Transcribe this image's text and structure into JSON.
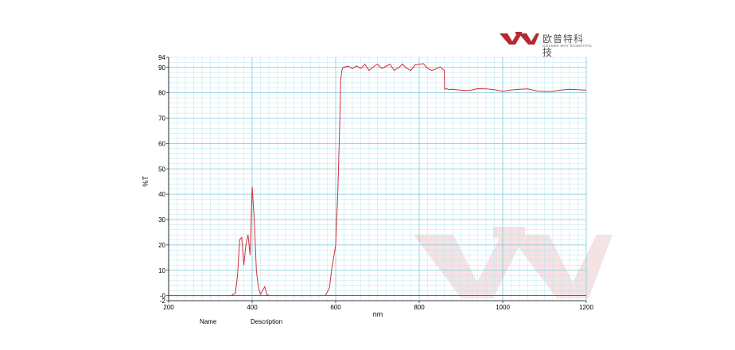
{
  "brand": {
    "name_cn": "欧普特科技",
    "name_en": "GOLDEN WAY SCIENTIFIC",
    "color": "#b7282e"
  },
  "footer": {
    "name_label": "Name",
    "description_label": "Description"
  },
  "chart_data": {
    "type": "line",
    "xlabel": "nm",
    "ylabel": "%T",
    "xlim": [
      200,
      1200
    ],
    "ylim": [
      -2,
      94
    ],
    "x_ticks": [
      200,
      400,
      600,
      800,
      1000,
      1200
    ],
    "y_ticks": [
      -2,
      0,
      10,
      20,
      30,
      40,
      50,
      60,
      70,
      80,
      90,
      94
    ],
    "y_tick_labels": [
      "-2",
      "-0",
      "10",
      "20",
      "30",
      "40",
      "50",
      "60",
      "70",
      "80",
      "90",
      "94"
    ],
    "grid": true,
    "line_color": "#d0303a",
    "grid_color": "#b8e4ee",
    "major_grid_color": "#7ec8dc",
    "series": [
      {
        "values_x": [
          200,
          350,
          360,
          365,
          370,
          375,
          380,
          385,
          390,
          395,
          400,
          405,
          410,
          415,
          420,
          425,
          430,
          435,
          440,
          450,
          500,
          550,
          575,
          585,
          590,
          595,
          600,
          605,
          610,
          612,
          615,
          618,
          622,
          630,
          640,
          650,
          660,
          670,
          680,
          690,
          700,
          710,
          720,
          730,
          740,
          750,
          760,
          770,
          780,
          790,
          800,
          810,
          820,
          830,
          840,
          850,
          860,
          861,
          865,
          870,
          880,
          900,
          920,
          940,
          960,
          980,
          1000,
          1020,
          1040,
          1060,
          1080,
          1100,
          1120,
          1140,
          1160,
          1180,
          1200
        ],
        "values_y": [
          0,
          0,
          1,
          8,
          22,
          23,
          12,
          20,
          24,
          16,
          43,
          30,
          10,
          3,
          0.5,
          2,
          3.5,
          0.5,
          0,
          0,
          0,
          0,
          0,
          3,
          10,
          15,
          20,
          40,
          70,
          85,
          89,
          90,
          90.2,
          90.5,
          89.5,
          90.6,
          89.6,
          91.2,
          88.8,
          90.2,
          91.3,
          89.6,
          90.4,
          91.3,
          88.8,
          89.8,
          91.3,
          89.6,
          88.8,
          91,
          91.2,
          91.5,
          89.6,
          88.8,
          89.4,
          90.2,
          88.8,
          81.4,
          81.6,
          81.3,
          81.4,
          81,
          80.9,
          81.6,
          81.5,
          81.2,
          80.6,
          81.1,
          81.4,
          81.5,
          80.8,
          80.5,
          80.6,
          81.1,
          81.4,
          81.2,
          81
        ]
      }
    ]
  }
}
